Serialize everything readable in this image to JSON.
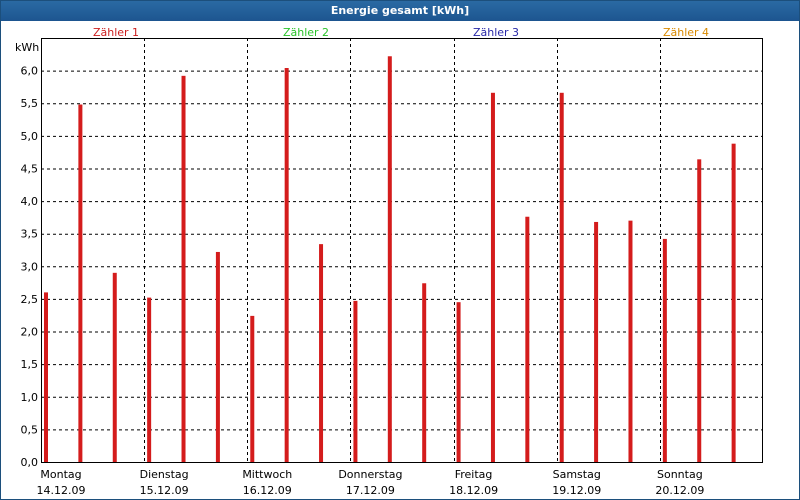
{
  "window": {
    "title": "Energie gesamt [kWh]"
  },
  "legend": {
    "entries": [
      {
        "label": "Zähler 1",
        "color": "#cc1f1f"
      },
      {
        "label": "Zähler 2",
        "color": "#2bc32b"
      },
      {
        "label": "Zähler 3",
        "color": "#2a2aa8"
      },
      {
        "label": "Zähler 4",
        "color": "#d98a00"
      }
    ]
  },
  "chart_data": {
    "type": "bar",
    "title": "Energie gesamt [kWh]",
    "ylabel": "kWh",
    "ylim": [
      0,
      6.5
    ],
    "yticks": [
      "0,0",
      "0,5",
      "1,0",
      "1,5",
      "2,0",
      "2,5",
      "3,0",
      "3,5",
      "4,0",
      "4,5",
      "5,0",
      "5,5",
      "6,0"
    ],
    "grid": true,
    "legend_position": "top",
    "bar_color": "#d41c1c",
    "days": [
      {
        "name": "Montag",
        "date": "14.12.09"
      },
      {
        "name": "Dienstag",
        "date": "15.12.09"
      },
      {
        "name": "Mittwoch",
        "date": "16.12.09"
      },
      {
        "name": "Donnerstag",
        "date": "17.12.09"
      },
      {
        "name": "Freitag",
        "date": "18.12.09"
      },
      {
        "name": "Samstag",
        "date": "19.12.09"
      },
      {
        "name": "Sonntag",
        "date": "20.12.09"
      }
    ],
    "bars_per_day": 3,
    "values": [
      2.6,
      5.48,
      2.9,
      2.52,
      5.92,
      3.22,
      2.24,
      6.04,
      3.34,
      2.47,
      6.22,
      2.74,
      2.45,
      5.66,
      3.76,
      5.66,
      3.68,
      3.7,
      3.42,
      4.64,
      4.88
    ]
  }
}
